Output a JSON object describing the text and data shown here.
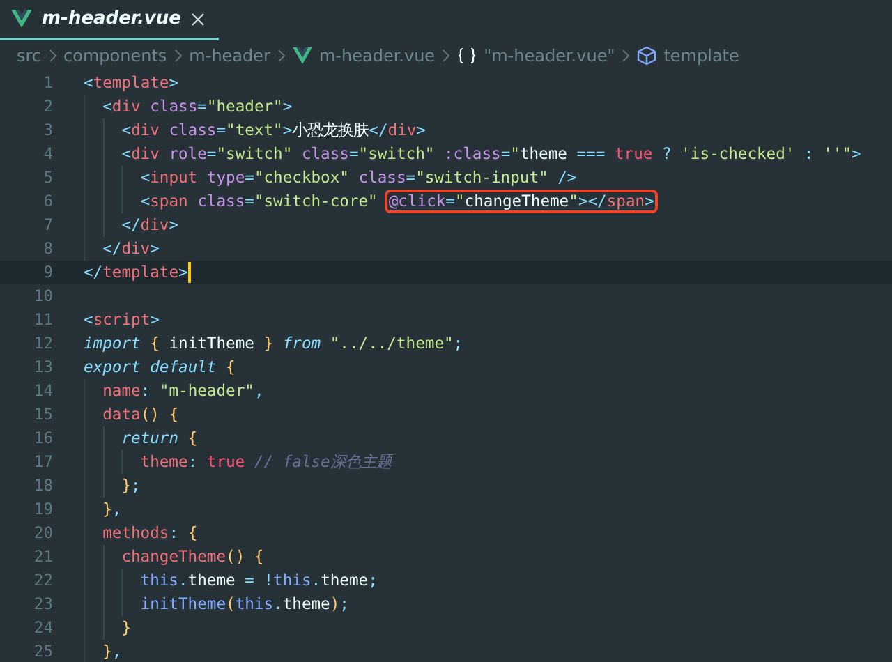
{
  "tabs": [
    {
      "label": "m-header.vue",
      "selected": true
    }
  ],
  "breadcrumb": [
    {
      "kind": "plain",
      "label": "src"
    },
    {
      "kind": "plain",
      "label": "components"
    },
    {
      "kind": "plain",
      "label": "m-header"
    },
    {
      "kind": "vue",
      "label": "m-header.vue"
    },
    {
      "kind": "object",
      "label": "\"m-header.vue\""
    },
    {
      "kind": "symbol",
      "label": "template"
    }
  ],
  "lines": [
    {
      "number": "1",
      "current": false,
      "tokens": [
        {
          "kind": "punct",
          "text": "<"
        },
        {
          "kind": "tag",
          "text": "template"
        },
        {
          "kind": "punct",
          "text": ">"
        }
      ],
      "children": [
        {
          "number": "2",
          "current": false,
          "tokens": [
            {
              "kind": "punct",
              "text": "<"
            },
            {
              "kind": "tag",
              "text": "div"
            },
            {
              "kind": "attr",
              "text": " class"
            },
            {
              "kind": "punct",
              "text": "="
            },
            {
              "kind": "string",
              "text": "\"header\""
            },
            {
              "kind": "punct",
              "text": ">"
            }
          ],
          "children": [
            {
              "number": "3",
              "current": false,
              "tokens": [
                {
                  "kind": "punct",
                  "text": "<"
                },
                {
                  "kind": "tag",
                  "text": "div"
                },
                {
                  "kind": "attr",
                  "text": " class"
                },
                {
                  "kind": "punct",
                  "text": "="
                },
                {
                  "kind": "string",
                  "text": "\"text\""
                },
                {
                  "kind": "punct",
                  "text": ">"
                },
                {
                  "kind": "plain",
                  "text": "小恐龙换肤"
                },
                {
                  "kind": "punct",
                  "text": "</"
                },
                {
                  "kind": "tag",
                  "text": "div"
                },
                {
                  "kind": "punct",
                  "text": ">"
                }
              ]
            },
            {
              "number": "4",
              "current": false,
              "tokens": [
                {
                  "kind": "punct",
                  "text": "<"
                },
                {
                  "kind": "tag",
                  "text": "div"
                },
                {
                  "kind": "attr",
                  "text": " role"
                },
                {
                  "kind": "punct",
                  "text": "="
                },
                {
                  "kind": "string",
                  "text": "\"switch\""
                },
                {
                  "kind": "attr",
                  "text": " class"
                },
                {
                  "kind": "punct",
                  "text": "="
                },
                {
                  "kind": "string",
                  "text": "\"switch\""
                },
                {
                  "kind": "attr",
                  "text": " :class"
                },
                {
                  "kind": "punct",
                  "text": "="
                },
                {
                  "kind": "string",
                  "text": "\""
                },
                {
                  "kind": "plain",
                  "text": "theme"
                },
                {
                  "kind": "punct",
                  "text": " === "
                },
                {
                  "kind": "bool",
                  "text": "true"
                },
                {
                  "kind": "punct",
                  "text": " ? "
                },
                {
                  "kind": "string",
                  "text": "'is-checked'"
                },
                {
                  "kind": "punct",
                  "text": " : "
                },
                {
                  "kind": "string",
                  "text": "''\""
                },
                {
                  "kind": "punct",
                  "text": ">"
                }
              ],
              "children": [
                {
                  "number": "5",
                  "current": false,
                  "tokens": [
                    {
                      "kind": "punct",
                      "text": "<"
                    },
                    {
                      "kind": "tag",
                      "text": "input"
                    },
                    {
                      "kind": "attr",
                      "text": " type"
                    },
                    {
                      "kind": "punct",
                      "text": "="
                    },
                    {
                      "kind": "string",
                      "text": "\"checkbox\""
                    },
                    {
                      "kind": "attr",
                      "text": " class"
                    },
                    {
                      "kind": "punct",
                      "text": "="
                    },
                    {
                      "kind": "string",
                      "text": "\"switch-input\""
                    },
                    {
                      "kind": "punct",
                      "text": " />"
                    }
                  ]
                },
                {
                  "number": "6",
                  "current": false,
                  "tokens": [
                    {
                      "kind": "punct",
                      "text": "<"
                    },
                    {
                      "kind": "tag",
                      "text": "span"
                    },
                    {
                      "kind": "attr",
                      "text": " class"
                    },
                    {
                      "kind": "punct",
                      "text": "="
                    },
                    {
                      "kind": "string",
                      "text": "\"switch-core\""
                    },
                    {
                      "kind": "box",
                      "tokens": [
                        {
                          "kind": "attr",
                          "text": "@click"
                        },
                        {
                          "kind": "punct",
                          "text": "="
                        },
                        {
                          "kind": "string",
                          "text": "\""
                        },
                        {
                          "kind": "plain",
                          "text": "changeTheme"
                        },
                        {
                          "kind": "string",
                          "text": "\""
                        },
                        {
                          "kind": "punct",
                          "text": "></"
                        },
                        {
                          "kind": "tag",
                          "text": "span"
                        },
                        {
                          "kind": "punct",
                          "text": ">"
                        }
                      ]
                    }
                  ]
                }
              ]
            },
            {
              "number": "7",
              "current": false,
              "tokens": [
                {
                  "kind": "punct",
                  "text": "</"
                },
                {
                  "kind": "tag",
                  "text": "div"
                },
                {
                  "kind": "punct",
                  "text": ">"
                }
              ]
            }
          ]
        },
        {
          "number": "8",
          "current": false,
          "tokens": [
            {
              "kind": "punct",
              "text": "</"
            },
            {
              "kind": "tag",
              "text": "div"
            },
            {
              "kind": "punct",
              "text": ">"
            }
          ]
        }
      ]
    },
    {
      "number": "9",
      "current": true,
      "tokens": [
        {
          "kind": "punct",
          "text": "</"
        },
        {
          "kind": "tag",
          "text": "template"
        },
        {
          "kind": "punct",
          "text": ">"
        }
      ]
    },
    {
      "number": "10",
      "current": false
    },
    {
      "number": "11",
      "current": false,
      "tokens": [
        {
          "kind": "punct",
          "text": "<"
        },
        {
          "kind": "tag",
          "text": "script"
        },
        {
          "kind": "punct",
          "text": ">"
        }
      ]
    },
    {
      "number": "12",
      "current": false,
      "tokens": [
        {
          "kind": "keyword",
          "text": "import"
        },
        {
          "kind": "brace",
          "text": " {"
        },
        {
          "kind": "plain",
          "text": " initTheme "
        },
        {
          "kind": "brace",
          "text": "}"
        },
        {
          "kind": "keyword",
          "text": " from"
        },
        {
          "kind": "string",
          "text": " \"../../theme\""
        },
        {
          "kind": "punct",
          "text": ";"
        }
      ]
    },
    {
      "number": "13",
      "current": false,
      "tokens": [
        {
          "kind": "keyword",
          "text": "export default"
        },
        {
          "kind": "brace",
          "text": " {"
        }
      ],
      "children": [
        {
          "number": "14",
          "current": false,
          "tokens": [
            {
              "kind": "prop",
              "text": "name"
            },
            {
              "kind": "punct",
              "text": ": "
            },
            {
              "kind": "string",
              "text": "\"m-header\""
            },
            {
              "kind": "punct",
              "text": ","
            }
          ]
        },
        {
          "number": "15",
          "current": false,
          "tokens": [
            {
              "kind": "prop",
              "text": "data"
            },
            {
              "kind": "brace",
              "text": "() {"
            }
          ],
          "children": [
            {
              "number": "16",
              "current": false,
              "tokens": [
                {
                  "kind": "keyword",
                  "text": "return"
                },
                {
                  "kind": "brace",
                  "text": " {"
                }
              ],
              "children": [
                {
                  "number": "17",
                  "current": false,
                  "tokens": [
                    {
                      "kind": "prop",
                      "text": "theme"
                    },
                    {
                      "kind": "punct",
                      "text": ": "
                    },
                    {
                      "kind": "bool",
                      "text": "true"
                    },
                    {
                      "kind": "comment",
                      "text": " // false深色主题"
                    }
                  ]
                }
              ]
            },
            {
              "number": "18",
              "current": false,
              "tokens": [
                {
                  "kind": "brace",
                  "text": "}"
                },
                {
                  "kind": "punct",
                  "text": ";"
                }
              ]
            }
          ]
        },
        {
          "number": "19",
          "current": false,
          "tokens": [
            {
              "kind": "brace",
              "text": "}"
            },
            {
              "kind": "punct",
              "text": ","
            }
          ]
        },
        {
          "number": "20",
          "current": false,
          "tokens": [
            {
              "kind": "prop",
              "text": "methods"
            },
            {
              "kind": "punct",
              "text": ": "
            },
            {
              "kind": "brace",
              "text": "{"
            }
          ],
          "children": [
            {
              "number": "21",
              "current": false,
              "tokens": [
                {
                  "kind": "prop",
                  "text": "changeTheme"
                },
                {
                  "kind": "brace",
                  "text": "() {"
                }
              ],
              "children": [
                {
                  "number": "22",
                  "current": false,
                  "tokens": [
                    {
                      "kind": "this",
                      "text": "this"
                    },
                    {
                      "kind": "punct",
                      "text": "."
                    },
                    {
                      "kind": "plain",
                      "text": "theme"
                    },
                    {
                      "kind": "punct",
                      "text": " = !"
                    },
                    {
                      "kind": "this",
                      "text": "this"
                    },
                    {
                      "kind": "punct",
                      "text": "."
                    },
                    {
                      "kind": "plain",
                      "text": "theme"
                    },
                    {
                      "kind": "punct",
                      "text": ";"
                    }
                  ]
                },
                {
                  "number": "23",
                  "current": false,
                  "tokens": [
                    {
                      "kind": "func",
                      "text": "initTheme"
                    },
                    {
                      "kind": "brace",
                      "text": "("
                    },
                    {
                      "kind": "this",
                      "text": "this"
                    },
                    {
                      "kind": "punct",
                      "text": "."
                    },
                    {
                      "kind": "plain",
                      "text": "theme"
                    },
                    {
                      "kind": "brace",
                      "text": ")"
                    },
                    {
                      "kind": "punct",
                      "text": ";"
                    }
                  ]
                }
              ]
            },
            {
              "number": "24",
              "current": false,
              "tokens": [
                {
                  "kind": "brace",
                  "text": "}"
                }
              ]
            }
          ]
        },
        {
          "number": "25",
          "current": false,
          "tokens": [
            {
              "kind": "brace",
              "text": "}"
            },
            {
              "kind": "punct",
              "text": ","
            }
          ]
        }
      ]
    }
  ]
}
